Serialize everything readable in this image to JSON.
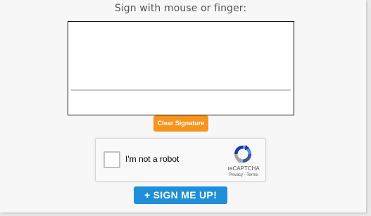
{
  "signature": {
    "instruction": "Sign with mouse or finger:",
    "clear_label": "Clear Signature"
  },
  "recaptcha": {
    "checkbox_label": "I'm not a robot",
    "brand": "reCAPTCHA",
    "privacy_link": "Privacy",
    "separator": " - ",
    "terms_link": "Terms",
    "icon": "recaptcha-logo-icon"
  },
  "form": {
    "submit_label": "+ SIGN ME UP!"
  },
  "colors": {
    "clear_button": "#f7941d",
    "submit_button": "#1e8fd8",
    "background": "#f7f7f7"
  }
}
